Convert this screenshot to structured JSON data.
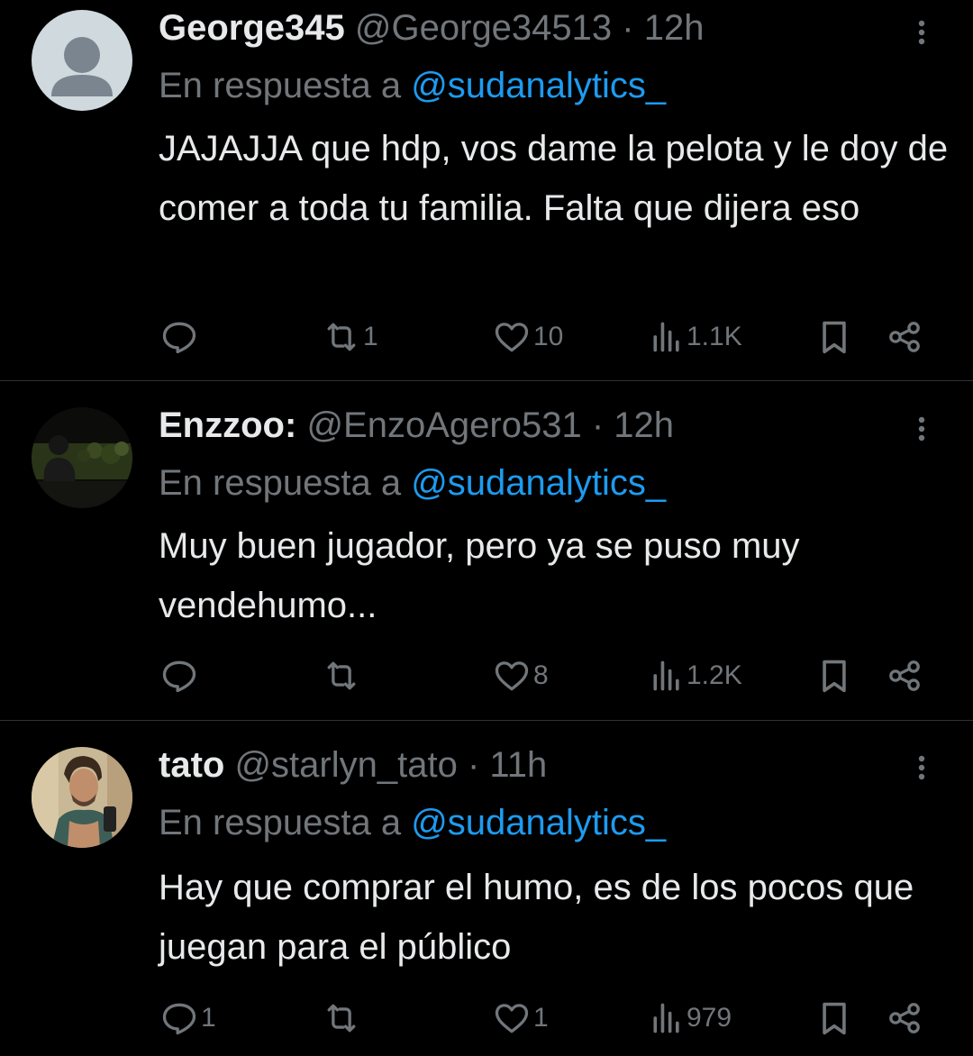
{
  "tweets": [
    {
      "display_name": "George345",
      "handle": "@George34513",
      "separator": "·",
      "time": "12h",
      "reply_prefix": "En respuesta a",
      "reply_mention": "@sudanalytics_",
      "text": "JAJAJJA que hdp, vos dame la pelota y le doy de comer a toda tu familia. Falta que dijera eso",
      "replies": "",
      "retweets": "1",
      "likes": "10",
      "views": "1.1K",
      "avatar": "default-avatar"
    },
    {
      "display_name": "Enzzoo:",
      "handle": "@EnzoAgero531",
      "separator": "·",
      "time": "12h",
      "reply_prefix": "En respuesta a",
      "reply_mention": "@sudanalytics_",
      "text": "Muy buen jugador, pero ya se puso muy vendehumo...",
      "replies": "",
      "retweets": "",
      "likes": "8",
      "views": "1.2K",
      "avatar": "photo-night-person"
    },
    {
      "display_name": "tato",
      "handle": "@starlyn_tato",
      "separator": "·",
      "time": "11h",
      "reply_prefix": "En respuesta a",
      "reply_mention": "@sudanalytics_",
      "text": "Hay que comprar el humo, es de los pocos que juegan para el público",
      "replies": "1",
      "retweets": "",
      "likes": "1",
      "views": "979",
      "avatar": "photo-selfie"
    }
  ],
  "icons": {
    "reply": "reply-icon",
    "retweet": "retweet-icon",
    "like": "like-icon",
    "views": "views-icon",
    "bookmark": "bookmark-icon",
    "share": "share-icon",
    "more": "more-icon"
  },
  "colors": {
    "background": "#000000",
    "text": "#e7e9ea",
    "muted": "#71767b",
    "link": "#1d9bf0",
    "divider": "#2f3336"
  }
}
